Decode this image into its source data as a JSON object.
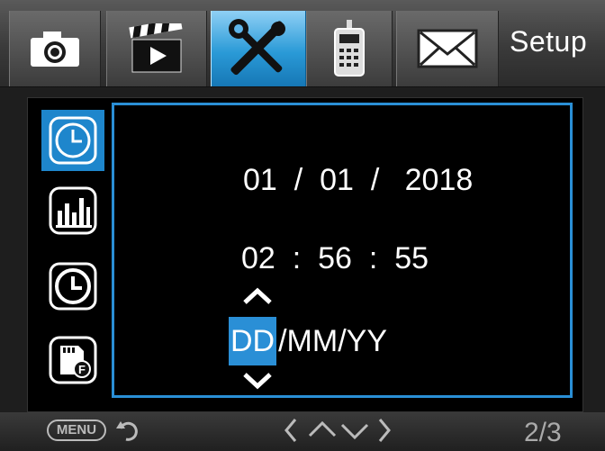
{
  "header": {
    "title": "Setup",
    "tabs": [
      {
        "icon": "camera-icon",
        "active": false
      },
      {
        "icon": "video-clapper-icon",
        "active": false
      },
      {
        "icon": "tools-icon",
        "active": true
      },
      {
        "icon": "cellular-phone-icon",
        "active": false
      },
      {
        "icon": "envelope-icon",
        "active": false
      }
    ]
  },
  "sidebar": {
    "items": [
      {
        "icon": "clock-icon",
        "active": true
      },
      {
        "icon": "bar-chart-icon",
        "active": false
      },
      {
        "icon": "timer-clock-icon",
        "active": false
      },
      {
        "icon": "sd-card-format-icon",
        "active": false
      }
    ]
  },
  "datetime": {
    "date": {
      "day": "01",
      "month": "01",
      "year": "2018",
      "separator": "/"
    },
    "time": {
      "hour": "02",
      "minute": "56",
      "second": "55",
      "separator": ":"
    },
    "format": {
      "selected": "DD",
      "rest": "/MM/YY"
    }
  },
  "footer": {
    "menu_label": "MENU",
    "page": "2/3"
  },
  "colors": {
    "accent": "#2a8fd6",
    "background": "#000000",
    "text": "#ffffff"
  }
}
